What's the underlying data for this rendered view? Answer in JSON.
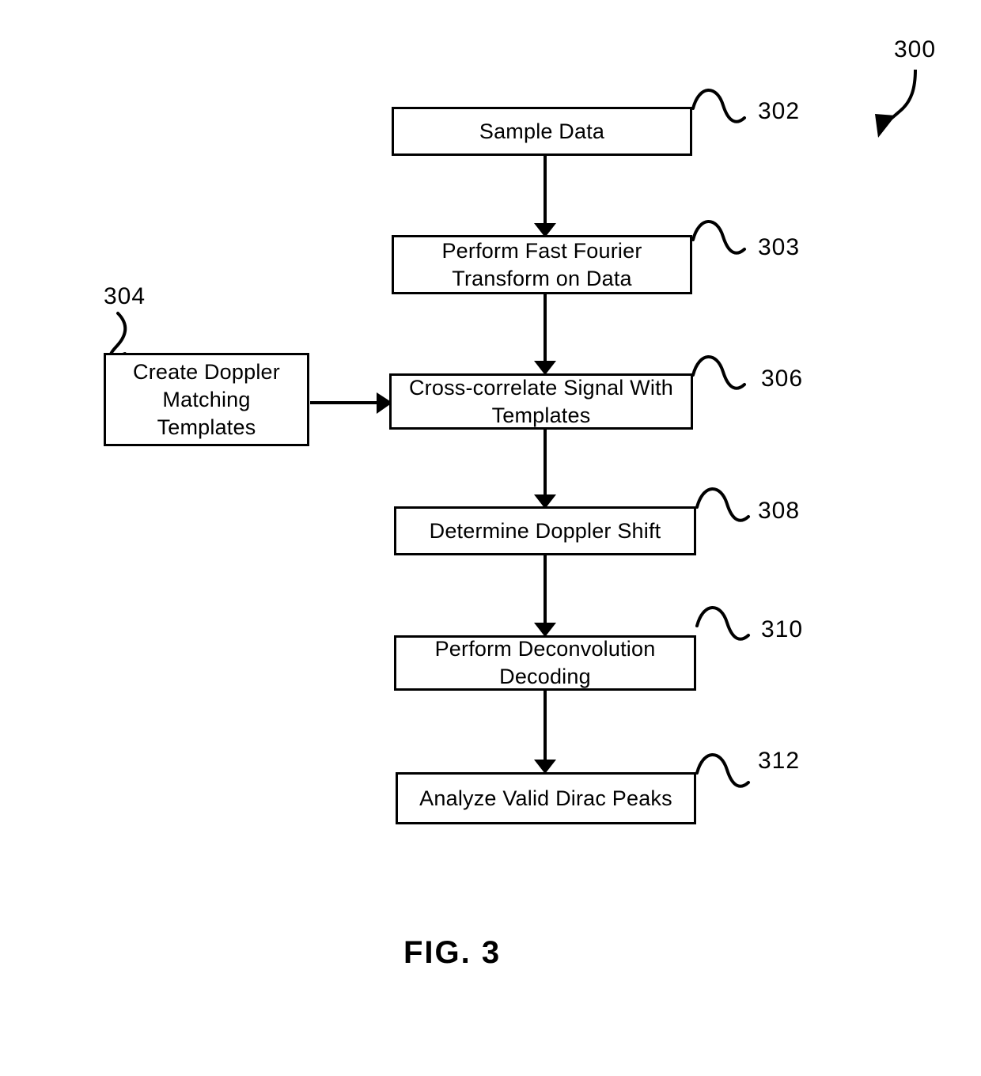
{
  "figure": {
    "caption": "FIG. 3",
    "diagram_ref": "300"
  },
  "nodes": [
    {
      "id": "sample-data",
      "label": "Sample Data",
      "ref": "302"
    },
    {
      "id": "perform-fft",
      "label": "Perform Fast Fourier\nTransform on Data",
      "ref": "303"
    },
    {
      "id": "create-doppler-templates",
      "label": "Create Doppler\nMatching\nTemplates",
      "ref": "304"
    },
    {
      "id": "cross-correlate",
      "label": "Cross-correlate Signal With\nTemplates",
      "ref": "306"
    },
    {
      "id": "determine-doppler-shift",
      "label": "Determine Doppler Shift",
      "ref": "308"
    },
    {
      "id": "perform-deconvolution",
      "label": "Perform Deconvolution\nDecoding",
      "ref": "310"
    },
    {
      "id": "analyze-dirac-peaks",
      "label": "Analyze Valid Dirac Peaks",
      "ref": "312"
    }
  ],
  "colors": {
    "stroke": "#000000",
    "background": "#ffffff"
  }
}
